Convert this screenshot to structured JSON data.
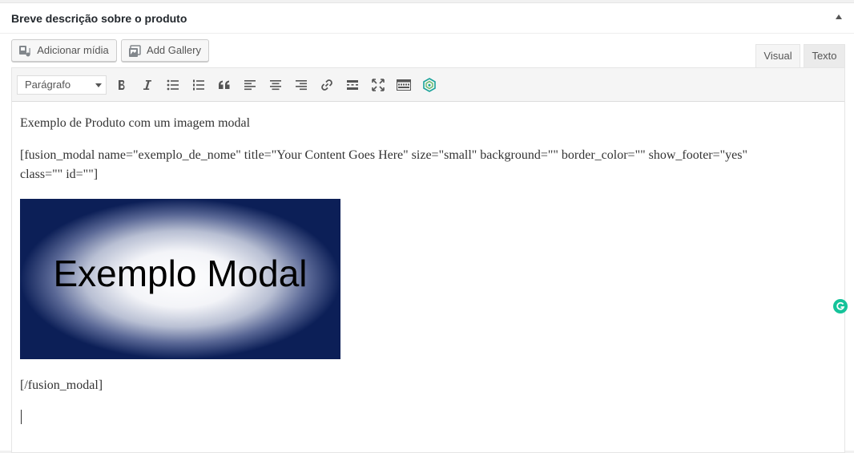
{
  "postbox": {
    "title": "Breve descrição sobre o produto",
    "toggle_icon": "arrow-up-icon"
  },
  "media_buttons": {
    "add_media": "Adicionar mídia",
    "add_gallery": "Add Gallery"
  },
  "tabs": {
    "visual": "Visual",
    "texto": "Texto",
    "active": "Visual"
  },
  "toolbar": {
    "format_select": "Parágrafo",
    "buttons": [
      "bold-icon",
      "italic-icon",
      "bullet-list-icon",
      "numbered-list-icon",
      "blockquote-icon",
      "align-left-icon",
      "align-center-icon",
      "align-right-icon",
      "link-icon",
      "read-more-icon",
      "fullscreen-icon",
      "toolbar-toggle-icon",
      "fusion-builder-icon"
    ]
  },
  "content": {
    "line1": "Exemplo de Produto com um imagem modal",
    "shortcode_open_line1": "[fusion_modal name=\"exemplo_de_nome\" title=\"Your Content Goes Here\" size=\"small\" background=\"\" border_color=\"\" show_footer=\"yes\"",
    "shortcode_open_line2": "class=\"\" id=\"\"]",
    "image_text": "Exemplo Modal",
    "shortcode_close": "[/fusion_modal]"
  },
  "colors": {
    "image_edge": "#0c1f57",
    "grammarly": "#15c39a",
    "fusion_icon": "#1aa39a"
  }
}
